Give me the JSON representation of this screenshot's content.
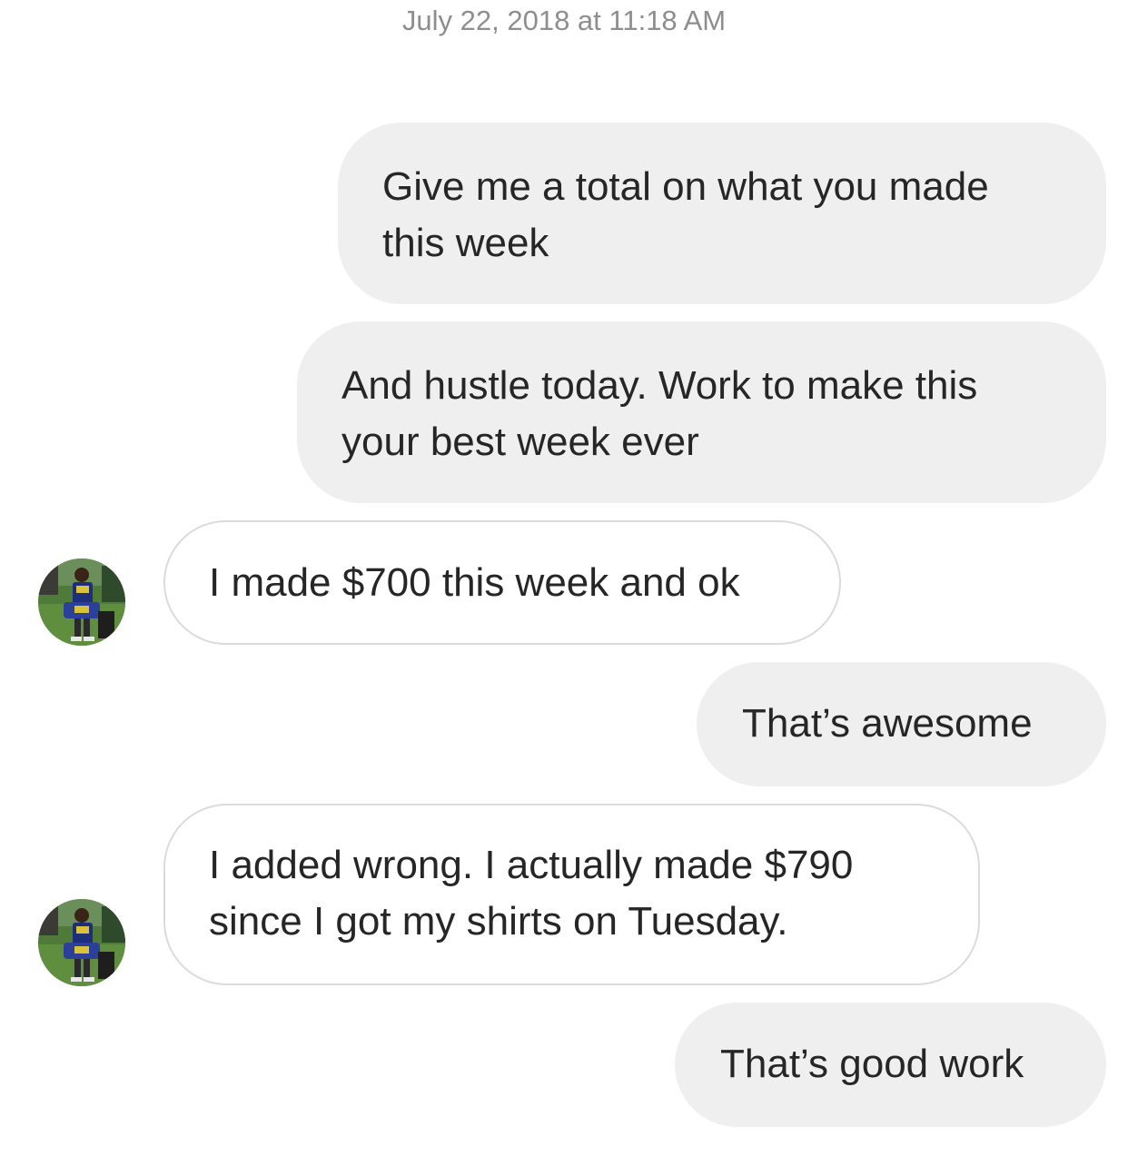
{
  "thread": {
    "timestamp": "July 22, 2018 at 11:18 AM",
    "messages": [
      {
        "sender": "me",
        "text": "Give me a total on what you made\nthis week"
      },
      {
        "sender": "me",
        "text": "And hustle today. Work to make this\nyour best week ever"
      },
      {
        "sender": "other",
        "text": "I made $700 this week and ok"
      },
      {
        "sender": "me",
        "text": "That’s awesome"
      },
      {
        "sender": "other",
        "text": "I added wrong. I actually made $790\nsince I got my shirts on Tuesday."
      },
      {
        "sender": "me",
        "text": "That’s good work"
      }
    ]
  },
  "colors": {
    "sent_bubble": "#efefef",
    "received_border": "#dbdbdb",
    "timestamp_text": "#8e8e8e",
    "message_text": "#262626"
  }
}
